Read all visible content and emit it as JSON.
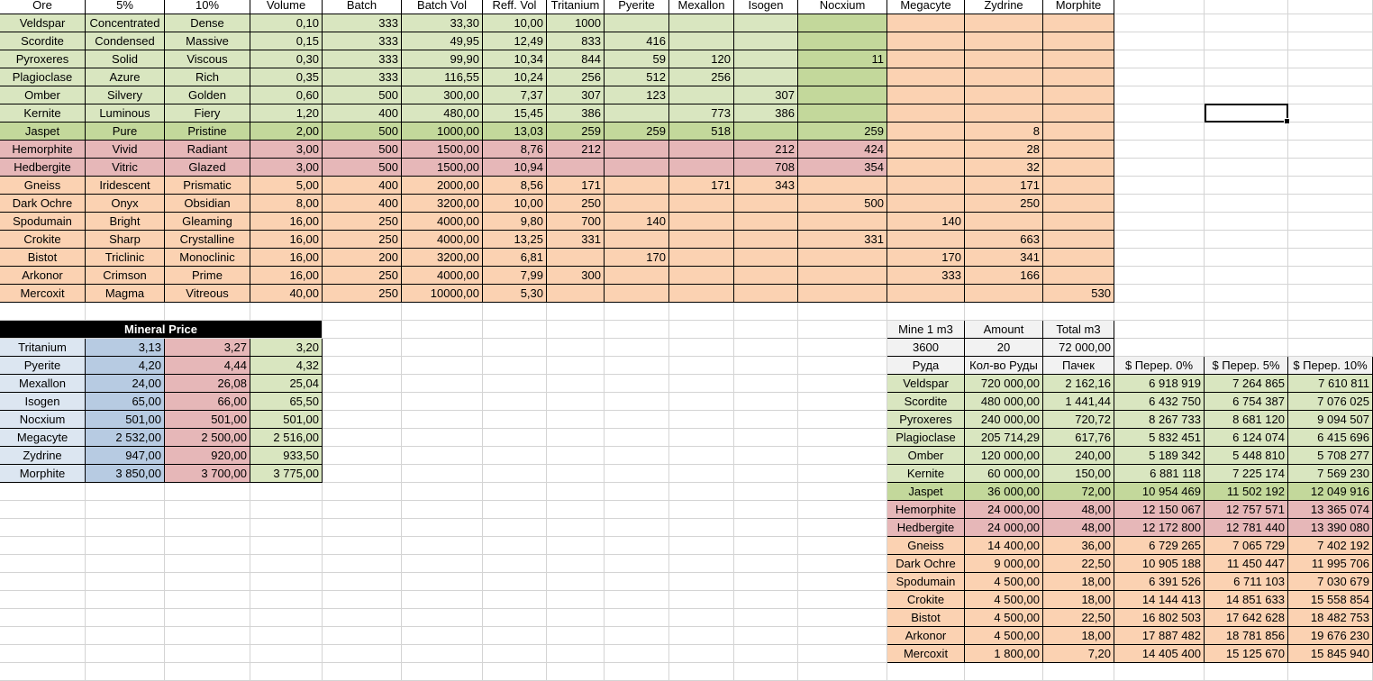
{
  "colors": {
    "green": "#d9e6c0",
    "olive": "#c3d89b",
    "orange": "#fbd2b2",
    "pink": "#e6b7b8",
    "blue": "#b7cbe2",
    "lightblue": "#dce6f1",
    "gray": "#f2f2f2",
    "white": "#ffffff"
  },
  "ore_table": {
    "columns": [
      "Ore",
      "5%",
      "10%",
      "Volume",
      "Batch",
      "Batch Vol",
      "Reff. Vol",
      "Tritanium",
      "Pyerite",
      "Mexallon",
      "Isogen",
      "Nocxium",
      "Megacyte",
      "Zydrine",
      "Morphite"
    ],
    "rows": [
      {
        "c": "green",
        "n": "",
        "v": [
          "Veldspar",
          "Concentrated",
          "Dense",
          "0,10",
          "333",
          "33,30",
          "10,00",
          "1000",
          "",
          "",
          "",
          "",
          "",
          "",
          ""
        ]
      },
      {
        "c": "green",
        "n": "",
        "v": [
          "Scordite",
          "Condensed",
          "Massive",
          "0,15",
          "333",
          "49,95",
          "12,49",
          "833",
          "416",
          "",
          "",
          "",
          "",
          "",
          ""
        ]
      },
      {
        "c": "green",
        "n": "",
        "v": [
          "Pyroxeres",
          "Solid",
          "Viscous",
          "0,30",
          "333",
          "99,90",
          "10,34",
          "844",
          "59",
          "120",
          "",
          "11",
          "",
          "",
          ""
        ]
      },
      {
        "c": "green",
        "n": "",
        "v": [
          "Plagioclase",
          "Azure",
          "Rich",
          "0,35",
          "333",
          "116,55",
          "10,24",
          "256",
          "512",
          "256",
          "",
          "",
          "",
          "",
          ""
        ]
      },
      {
        "c": "green",
        "n": "",
        "v": [
          "Omber",
          "Silvery",
          "Golden",
          "0,60",
          "500",
          "300,00",
          "7,37",
          "307",
          "123",
          "",
          "307",
          "",
          "",
          "",
          ""
        ]
      },
      {
        "c": "green",
        "n": "",
        "v": [
          "Kernite",
          "Luminous",
          "Fiery",
          "1,20",
          "400",
          "480,00",
          "15,45",
          "386",
          "",
          "773",
          "386",
          "",
          "",
          "",
          ""
        ]
      },
      {
        "c": "olive",
        "n": "",
        "v": [
          "Jaspet",
          "Pure",
          "Pristine",
          "2,00",
          "500",
          "1000,00",
          "13,03",
          "259",
          "259",
          "518",
          "",
          "259",
          "",
          "8",
          ""
        ]
      },
      {
        "c": "pink",
        "n": "",
        "v": [
          "Hemorphite",
          "Vivid",
          "Radiant",
          "3,00",
          "500",
          "1500,00",
          "8,76",
          "212",
          "",
          "",
          "212",
          "424",
          "",
          "28",
          ""
        ]
      },
      {
        "c": "pink",
        "n": "",
        "v": [
          "Hedbergite",
          "Vitric",
          "Glazed",
          "3,00",
          "500",
          "1500,00",
          "10,94",
          "",
          "",
          "",
          "708",
          "354",
          "",
          "32",
          ""
        ]
      },
      {
        "c": "orange",
        "n": "",
        "v": [
          "Gneiss",
          "Iridescent",
          "Prismatic",
          "5,00",
          "400",
          "2000,00",
          "8,56",
          "171",
          "",
          "171",
          "343",
          "",
          "",
          "171",
          ""
        ]
      },
      {
        "c": "orange",
        "n": "",
        "v": [
          "Dark Ochre",
          "Onyx",
          "Obsidian",
          "8,00",
          "400",
          "3200,00",
          "10,00",
          "250",
          "",
          "",
          "",
          "500",
          "",
          "250",
          ""
        ]
      },
      {
        "c": "orange",
        "n": "",
        "v": [
          "Spodumain",
          "Bright",
          "Gleaming",
          "16,00",
          "250",
          "4000,00",
          "9,80",
          "700",
          "140",
          "",
          "",
          "",
          "140",
          "",
          ""
        ]
      },
      {
        "c": "orange",
        "n": "",
        "v": [
          "Crokite",
          "Sharp",
          "Crystalline",
          "16,00",
          "250",
          "4000,00",
          "13,25",
          "331",
          "",
          "",
          "",
          "331",
          "",
          "663",
          ""
        ]
      },
      {
        "c": "orange",
        "n": "",
        "v": [
          "Bistot",
          "Triclinic",
          "Monoclinic",
          "16,00",
          "200",
          "3200,00",
          "6,81",
          "",
          "170",
          "",
          "",
          "",
          "170",
          "341",
          ""
        ]
      },
      {
        "c": "orange",
        "n": "",
        "v": [
          "Arkonor",
          "Crimson",
          "Prime",
          "16,00",
          "250",
          "4000,00",
          "7,99",
          "300",
          "",
          "",
          "",
          "",
          "333",
          "166",
          ""
        ]
      },
      {
        "c": "orange",
        "n": "",
        "v": [
          "Mercoxit",
          "Magma",
          "Vitreous",
          "40,00",
          "250",
          "10000,00",
          "5,30",
          "",
          "",
          "",
          "",
          "",
          "",
          "",
          "530"
        ]
      }
    ]
  },
  "mineral_price": {
    "title": "Mineral Price",
    "rows": [
      [
        "Tritanium",
        "3,13",
        "3,27",
        "3,20"
      ],
      [
        "Pyerite",
        "4,20",
        "4,44",
        "4,32"
      ],
      [
        "Mexallon",
        "24,00",
        "26,08",
        "25,04"
      ],
      [
        "Isogen",
        "65,00",
        "66,00",
        "65,50"
      ],
      [
        "Nocxium",
        "501,00",
        "501,00",
        "501,00"
      ],
      [
        "Megacyte",
        "2 532,00",
        "2 500,00",
        "2 516,00"
      ],
      [
        "Zydrine",
        "947,00",
        "920,00",
        "933,50"
      ],
      [
        "Morphite",
        "3 850,00",
        "3 700,00",
        "3 775,00"
      ]
    ]
  },
  "mine_calc": {
    "header": [
      "Mine 1 m3",
      "Amount",
      "Total m3"
    ],
    "values": [
      "3600",
      "20",
      "72 000,00"
    ],
    "columns": [
      "Руда",
      "Кол-во Руды",
      "Пачек",
      "$ Перер. 0%",
      "$ Перер. 5%",
      "$ Перер. 10%"
    ],
    "rows": [
      {
        "c": "green",
        "v": [
          "Veldspar",
          "720 000,00",
          "2 162,16",
          "6 918 919",
          "7 264 865",
          "7 610 811"
        ]
      },
      {
        "c": "green",
        "v": [
          "Scordite",
          "480 000,00",
          "1 441,44",
          "6 432 750",
          "6 754 387",
          "7 076 025"
        ]
      },
      {
        "c": "green",
        "v": [
          "Pyroxeres",
          "240 000,00",
          "720,72",
          "8 267 733",
          "8 681 120",
          "9 094 507"
        ]
      },
      {
        "c": "green",
        "v": [
          "Plagioclase",
          "205 714,29",
          "617,76",
          "5 832 451",
          "6 124 074",
          "6 415 696"
        ]
      },
      {
        "c": "green",
        "v": [
          "Omber",
          "120 000,00",
          "240,00",
          "5 189 342",
          "5 448 810",
          "5 708 277"
        ]
      },
      {
        "c": "green",
        "v": [
          "Kernite",
          "60 000,00",
          "150,00",
          "6 881 118",
          "7 225 174",
          "7 569 230"
        ]
      },
      {
        "c": "olive",
        "v": [
          "Jaspet",
          "36 000,00",
          "72,00",
          "10 954 469",
          "11 502 192",
          "12 049 916"
        ]
      },
      {
        "c": "pink",
        "v": [
          "Hemorphite",
          "24 000,00",
          "48,00",
          "12 150 067",
          "12 757 571",
          "13 365 074"
        ]
      },
      {
        "c": "pink",
        "v": [
          "Hedbergite",
          "24 000,00",
          "48,00",
          "12 172 800",
          "12 781 440",
          "13 390 080"
        ]
      },
      {
        "c": "orange",
        "v": [
          "Gneiss",
          "14 400,00",
          "36,00",
          "6 729 265",
          "7 065 729",
          "7 402 192"
        ]
      },
      {
        "c": "orange",
        "v": [
          "Dark Ochre",
          "9 000,00",
          "22,50",
          "10 905 188",
          "11 450 447",
          "11 995 706"
        ]
      },
      {
        "c": "orange",
        "v": [
          "Spodumain",
          "4 500,00",
          "18,00",
          "6 391 526",
          "6 711 103",
          "7 030 679"
        ]
      },
      {
        "c": "orange",
        "v": [
          "Crokite",
          "4 500,00",
          "18,00",
          "14 144 413",
          "14 851 633",
          "15 558 854"
        ]
      },
      {
        "c": "orange",
        "v": [
          "Bistot",
          "4 500,00",
          "22,50",
          "16 802 503",
          "17 642 628",
          "18 482 753"
        ]
      },
      {
        "c": "orange",
        "v": [
          "Arkonor",
          "4 500,00",
          "18,00",
          "17 887 482",
          "18 781 856",
          "19 676 230"
        ]
      },
      {
        "c": "orange",
        "v": [
          "Mercoxit",
          "1 800,00",
          "7,20",
          "14 405 400",
          "15 125 670",
          "15 845 940"
        ]
      }
    ]
  }
}
